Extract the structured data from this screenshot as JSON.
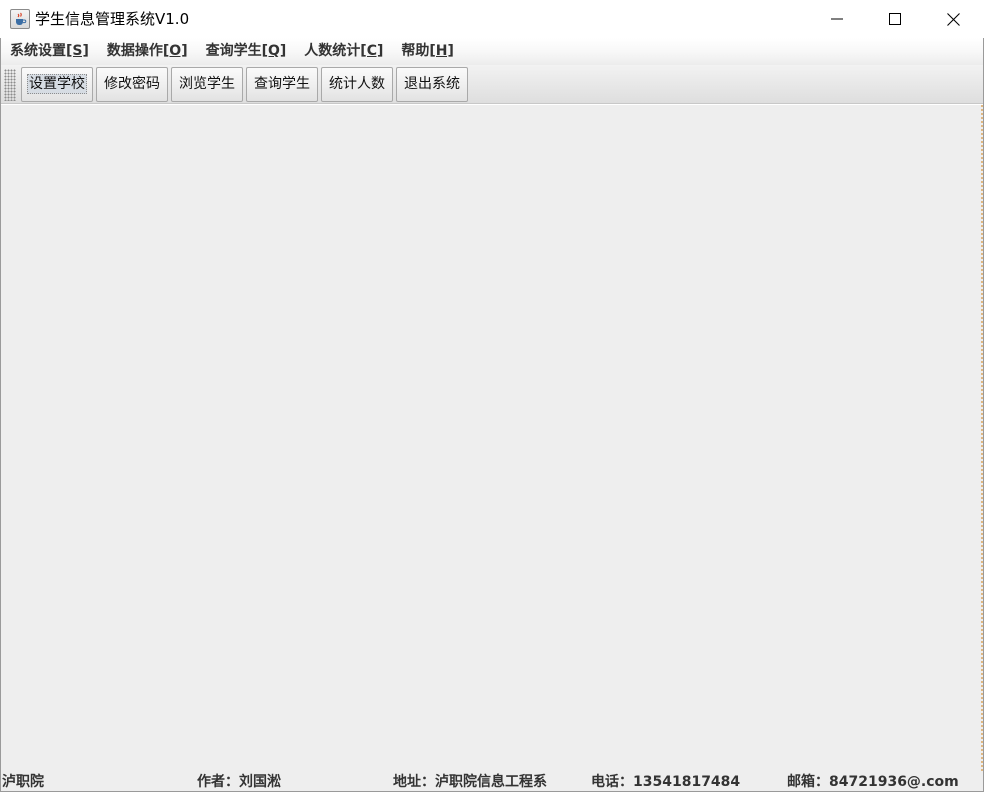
{
  "window": {
    "title": "学生信息管理系统V1.0",
    "icon": "java-cup-icon"
  },
  "menubar": {
    "items": [
      {
        "label": "系统设置",
        "mnemonic": "[S]"
      },
      {
        "label": "数据操作",
        "mnemonic": "[O]"
      },
      {
        "label": "查询学生",
        "mnemonic": "[Q]"
      },
      {
        "label": "人数统计",
        "mnemonic": "[C]"
      },
      {
        "label": "帮助",
        "mnemonic": "[H]"
      }
    ]
  },
  "toolbar": {
    "buttons": [
      {
        "label": "设置学校"
      },
      {
        "label": "修改密码"
      },
      {
        "label": "浏览学生"
      },
      {
        "label": "查询学生"
      },
      {
        "label": "统计人数"
      },
      {
        "label": "退出系统"
      }
    ]
  },
  "statusbar": {
    "org": "泸职院",
    "author": "作者：刘国淞",
    "address": "地址：泸职院信息工程系",
    "phone": "电话：13541817484",
    "email": "邮箱：84721936@.com"
  }
}
